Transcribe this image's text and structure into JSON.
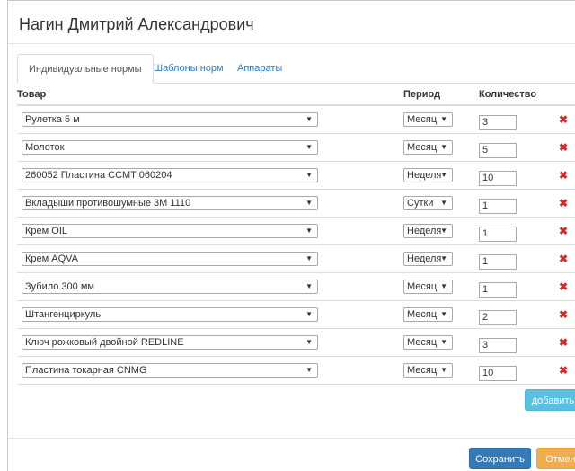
{
  "modal": {
    "title": "Нагин Дмитрий Александрович"
  },
  "tabs": [
    {
      "label": "Индивидуальные нормы",
      "active": true
    },
    {
      "label": "Шаблоны норм",
      "active": false
    },
    {
      "label": "Аппараты",
      "active": false
    }
  ],
  "table": {
    "headers": {
      "product": "Товар",
      "period": "Период",
      "quantity": "Количество"
    },
    "rows": [
      {
        "product": "Рулетка 5 м",
        "period": "Месяц",
        "quantity": "3"
      },
      {
        "product": "Молоток",
        "period": "Месяц",
        "quantity": "5"
      },
      {
        "product": "260052 Пластина CCMT 060204",
        "period": "Неделя",
        "quantity": "10"
      },
      {
        "product": "Вкладыши противошумные 3М 1110",
        "period": "Сутки",
        "quantity": "1"
      },
      {
        "product": "Крем OIL",
        "period": "Неделя",
        "quantity": "1"
      },
      {
        "product": "Крем AQVA",
        "period": "Неделя",
        "quantity": "1"
      },
      {
        "product": "Зубило 300 мм",
        "period": "Месяц",
        "quantity": "1"
      },
      {
        "product": "Штангенциркуль",
        "period": "Месяц",
        "quantity": "2"
      },
      {
        "product": "Ключ рожковый двойной REDLINE",
        "period": "Месяц",
        "quantity": "3"
      },
      {
        "product": "Пластина токарная CNMG",
        "period": "Месяц",
        "quantity": "10"
      }
    ]
  },
  "icons": {
    "dropdown": "▼",
    "delete": "✖"
  },
  "buttons": {
    "add": "добавить",
    "save": "Сохранить",
    "cancel": "Отмена"
  },
  "colors": {
    "primary": "#337ab7",
    "info": "#5bc0de",
    "warning": "#f0ad4e",
    "danger": "#c9302c"
  }
}
